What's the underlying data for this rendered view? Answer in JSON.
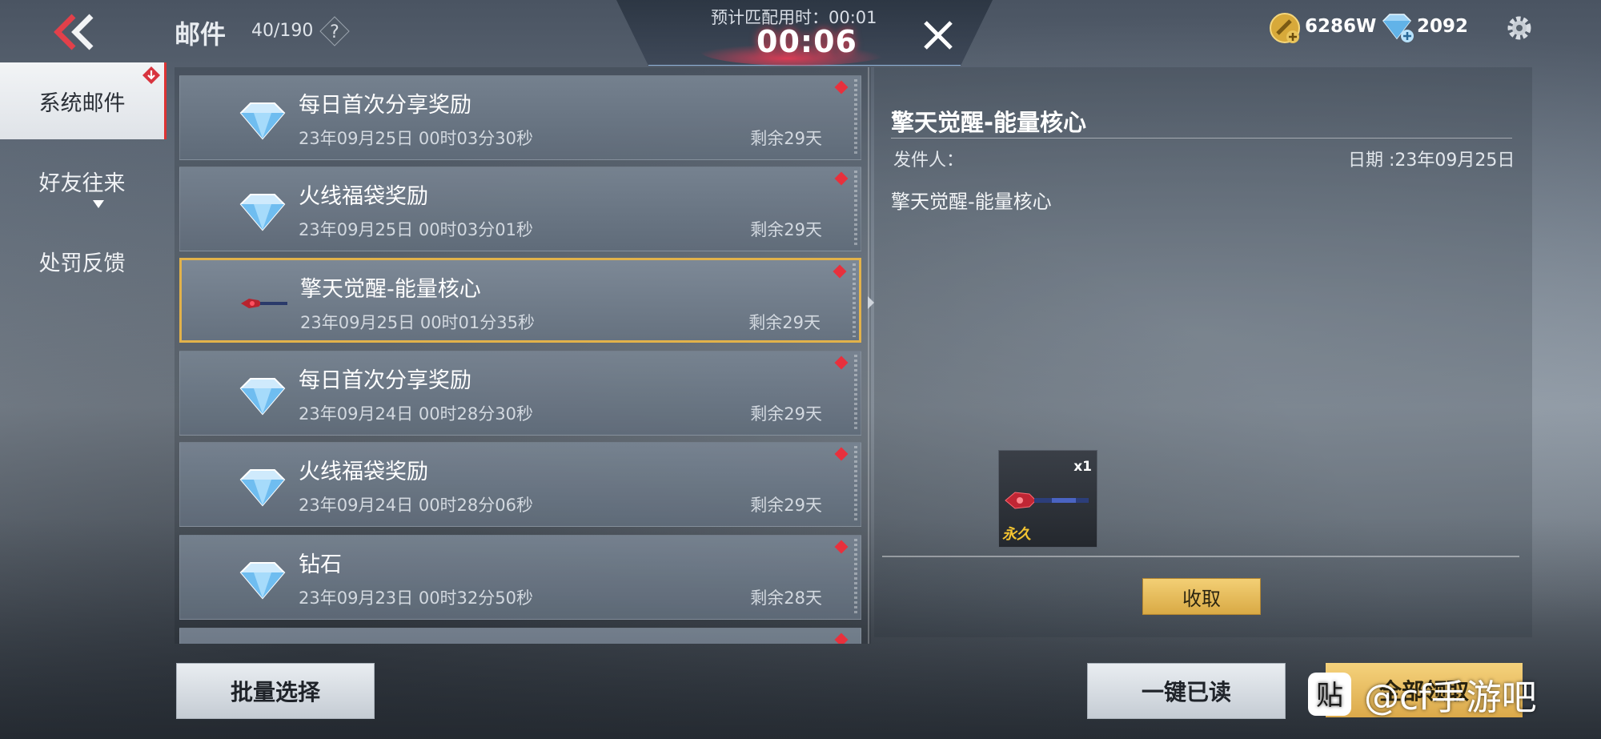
{
  "header": {
    "title": "邮件",
    "count": "40/190",
    "help": "?",
    "match_label": "预计匹配用时：00:01",
    "match_timer": "00:06",
    "gold": "6286W",
    "diamonds": "2092"
  },
  "sidebar": {
    "items": [
      {
        "label": "系统邮件",
        "active": true
      },
      {
        "label": "好友往来",
        "active": false
      },
      {
        "label": "处罚反馈",
        "active": false
      }
    ]
  },
  "mails": [
    {
      "title": "每日首次分享奖励",
      "date": "23年09月25日 00时03分30秒",
      "remain": "剩余29天",
      "icon": "diamond-icon"
    },
    {
      "title": "火线福袋奖励",
      "date": "23年09月25日 00时03分01秒",
      "remain": "剩余29天",
      "icon": "diamond-icon"
    },
    {
      "title": "擎天觉醒-能量核心",
      "date": "23年09月25日 00时01分35秒",
      "remain": "剩余29天",
      "icon": "weapon-icon",
      "selected": true
    },
    {
      "title": "每日首次分享奖励",
      "date": "23年09月24日 00时28分30秒",
      "remain": "剩余29天",
      "icon": "diamond-icon"
    },
    {
      "title": "火线福袋奖励",
      "date": "23年09月24日 00时28分06秒",
      "remain": "剩余29天",
      "icon": "diamond-icon"
    },
    {
      "title": "钻石",
      "date": "23年09月23日 00时32分50秒",
      "remain": "剩余28天",
      "icon": "diamond-icon"
    }
  ],
  "detail": {
    "title": "擎天觉醒-能量核心",
    "sender_label": "发件人：",
    "date": "日期 :23年09月25日",
    "body": "擎天觉醒-能量核心",
    "attachment": {
      "qty": "x1",
      "tag": "永久"
    },
    "claim": "收取"
  },
  "footer": {
    "batch_select": "批量选择",
    "mark_all_read": "一键已读",
    "claim_all": "全部领取",
    "watermark_logo": "贴",
    "watermark_text": "@cf手游吧"
  },
  "colors": {
    "accent_gold": "#e2b24a",
    "unread_red": "#e8303c"
  }
}
